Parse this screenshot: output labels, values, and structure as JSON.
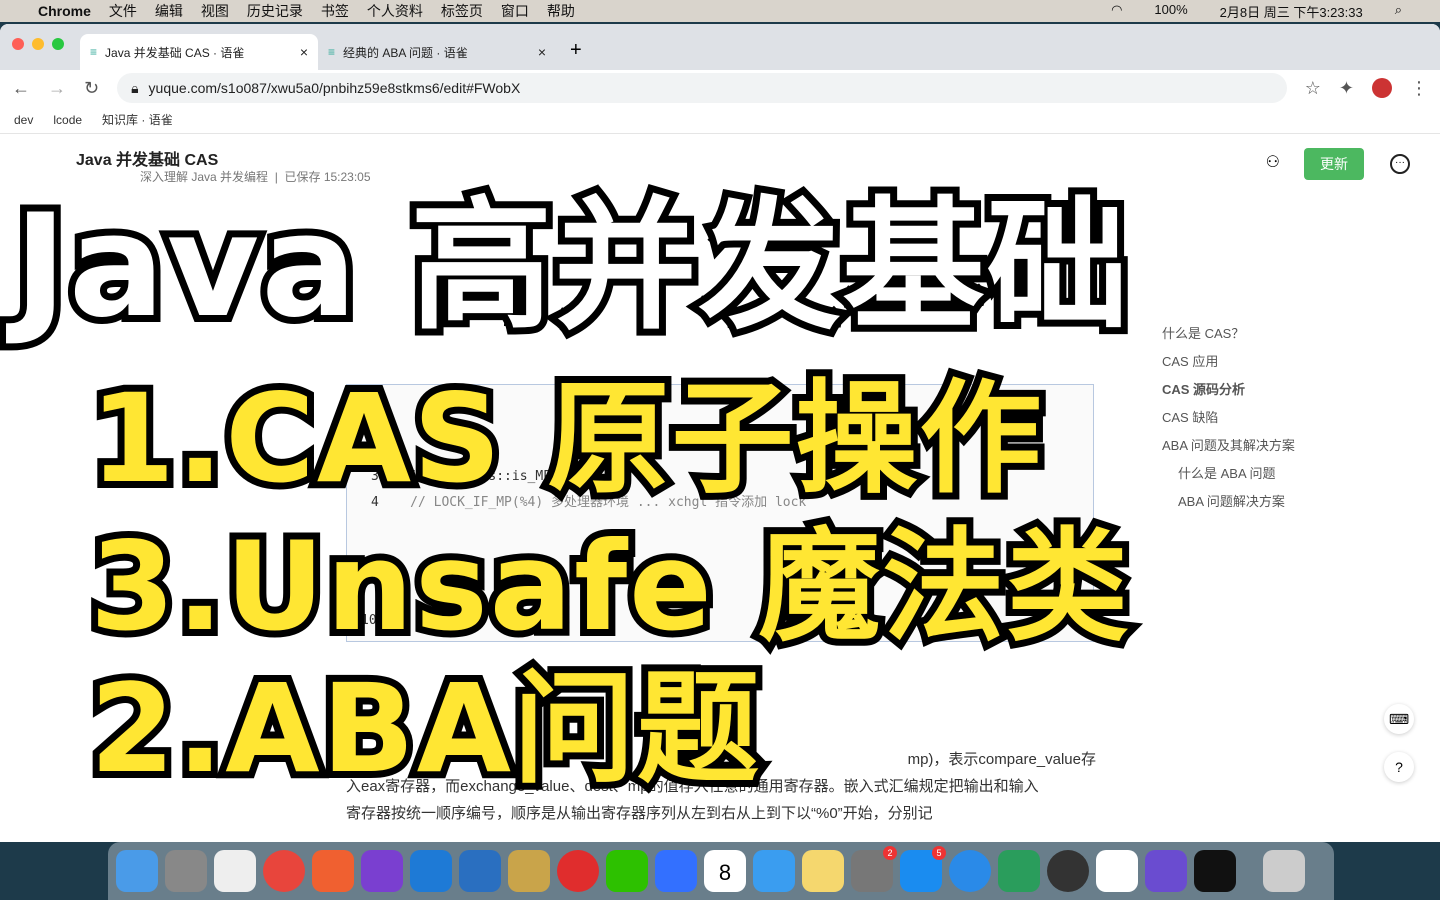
{
  "menubar": {
    "app": "Chrome",
    "items": [
      "文件",
      "编辑",
      "视图",
      "历史记录",
      "书签",
      "个人资料",
      "标签页",
      "窗口",
      "帮助"
    ],
    "battery": "100%",
    "datetime": "2月8日 周三 下午3:23:33"
  },
  "tabs": [
    {
      "title": "Java 并发基础 CAS · 语雀"
    },
    {
      "title": "经典的 ABA 问题 · 语雀"
    }
  ],
  "address": {
    "url": "yuque.com/s1o087/xwu5a0/pnbihz59e8stkms6/edit#FWobX"
  },
  "bookmarks": [
    "dev",
    "lcode",
    "知识库 · 语雀"
  ],
  "doc": {
    "title": "Java 并发基础 CAS",
    "book": "深入理解 Java 并发编程",
    "saved": "已保存 15:23:05",
    "update_label": "更新",
    "font_size": "15px",
    "code_lines": [
      {
        "n": "3",
        "text": "int mp = os::is_MP();"
      },
      {
        "n": "4",
        "text": "// LOCK_IF_MP(%4) 多处理器环境 ... xchgl 指令添加 lock"
      },
      {
        "n": "10",
        "text": "}"
      }
    ],
    "paragraph": [
      "mp)，表示compare_value存",
      "入eax寄存器，而exchange_value、dest、mp的值存入任意的通用寄存器。嵌入式汇编规定把输出和输入",
      "寄存器按统一顺序编号，顺序是从输出寄存器序列从左到右从上到下以“%0”开始，分别记"
    ]
  },
  "toc": [
    "什么是 CAS？",
    "CAS 应用",
    "CAS 源码分析",
    "CAS 缺陷",
    "ABA 问题及其解决方案",
    "什么是 ABA 问题",
    "ABA 问题解决方案"
  ],
  "overlay": [
    "Java 高并发基础",
    "1.CAS 原子操作",
    "3.Unsafe 魔法类",
    "2.ABA问题"
  ],
  "dock": {
    "calendar_day": "8",
    "badges": [
      "2",
      "5"
    ]
  }
}
